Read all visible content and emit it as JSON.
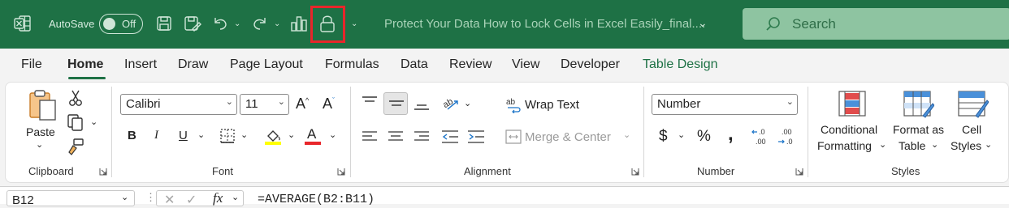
{
  "titlebar": {
    "autosave_label": "AutoSave",
    "autosave_state": "Off",
    "document_title": "Protect Your Data How to Lock Cells in Excel Easily_final....",
    "search_placeholder": "Search",
    "highlight_color": "#e8262b",
    "bg_color": "#1e7145"
  },
  "menu": {
    "tabs": [
      "File",
      "Home",
      "Insert",
      "Draw",
      "Page Layout",
      "Formulas",
      "Data",
      "Review",
      "View",
      "Developer",
      "Table Design"
    ],
    "active": "Home"
  },
  "ribbon": {
    "clipboard": {
      "paste_label": "Paste",
      "group_label": "Clipboard"
    },
    "font": {
      "font_name": "Calibri",
      "font_size": "11",
      "group_label": "Font",
      "bold": "B",
      "italic": "I",
      "underline": "U",
      "highlight_color": "#ffff00",
      "font_color": "#e8262b"
    },
    "alignment": {
      "wrap_text": "Wrap Text",
      "merge_center": "Merge & Center",
      "group_label": "Alignment"
    },
    "number": {
      "format": "Number",
      "currency": "$",
      "percent": "%",
      "comma": "͗",
      "inc_decimal": "←.0\n.00",
      "dec_decimal": ".00\n→.0",
      "group_label": "Number"
    },
    "styles": {
      "conditional_1": "Conditional",
      "conditional_2": "Formatting",
      "format_table_1": "Format as",
      "format_table_2": "Table",
      "cell_styles_1": "Cell",
      "cell_styles_2": "Styles",
      "group_label": "Styles"
    }
  },
  "formula_bar": {
    "name_box": "B12",
    "fx": "fx",
    "formula": "=AVERAGE(B2:B11)"
  }
}
